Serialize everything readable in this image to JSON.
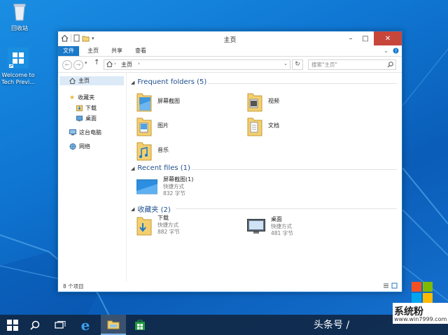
{
  "desktop": {
    "recycle_bin_label": "回收站",
    "welcome_label_1": "Welcome to",
    "welcome_label_2": "Tech Previ..."
  },
  "window": {
    "title": "主页",
    "ribbon_tabs": [
      "文件",
      "主页",
      "共享",
      "查看"
    ],
    "address": "主页",
    "search_placeholder": "搜索\"主页\"",
    "status": "8 个项目"
  },
  "nav": {
    "home": "主页",
    "favorites": "收藏夹",
    "downloads": "下载",
    "desktop": "桌面",
    "this_pc": "这台电脑",
    "network": "网络"
  },
  "groups": {
    "frequent": "Frequent folders (5)",
    "recent": "Recent files (1)",
    "favorites": "收藏夹 (2)"
  },
  "frequent_folders": [
    "屏幕截图",
    "视频",
    "图片",
    "文档",
    "音乐"
  ],
  "recent_files": [
    {
      "name": "屏幕截图(1)",
      "type": "快捷方式",
      "size": "832 字节"
    }
  ],
  "favorites": [
    {
      "name": "下载",
      "type": "快捷方式",
      "size": "882 字节"
    },
    {
      "name": "桌面",
      "type": "快捷方式",
      "size": "481 字节"
    }
  ],
  "watermark": "头条号 /",
  "brand": {
    "name": "系统粉",
    "url": "www.win7999.com"
  },
  "colors": {
    "accent": "#1979ca",
    "close": "#c7463c",
    "group_header": "#1e4e8c"
  }
}
